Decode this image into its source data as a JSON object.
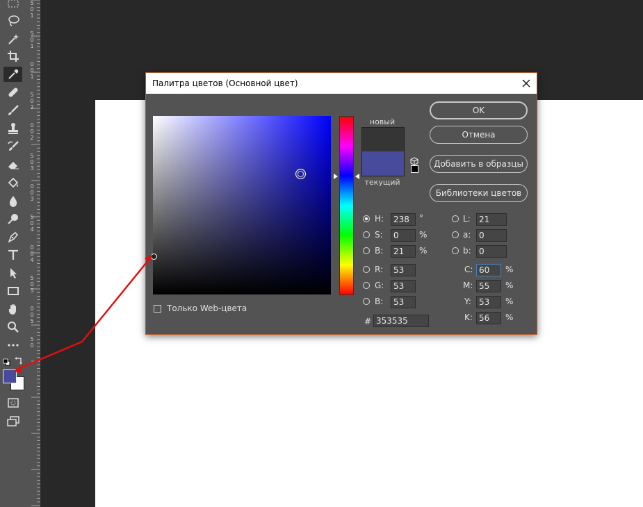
{
  "dialog": {
    "title": "Палитра цветов (Основной цвет)",
    "new_label": "новый",
    "current_label": "текущий",
    "new_color": "#353535",
    "current_color": "#484a9c",
    "buttons": {
      "ok": "OK",
      "cancel": "Отмена",
      "add_swatches": "Добавить в образцы",
      "libraries": "Библиотеки цветов"
    },
    "web_only_label": "Только Web-цвета",
    "hsb": {
      "h_label": "H:",
      "h_value": "238",
      "h_unit": "°",
      "s_label": "S:",
      "s_value": "0",
      "s_unit": "%",
      "b_label": "B:",
      "b_value": "21",
      "b_unit": "%"
    },
    "rgb": {
      "r_label": "R:",
      "r_value": "53",
      "g_label": "G:",
      "g_value": "53",
      "b_label": "B:",
      "b_value": "53"
    },
    "hex_label": "#",
    "hex_value": "353535",
    "lab": {
      "l_label": "L:",
      "l_value": "21",
      "a_label": "a:",
      "a_value": "0",
      "b_label": "b:",
      "b_value": "0"
    },
    "cmyk": {
      "c_label": "C:",
      "c_value": "60",
      "m_label": "M:",
      "m_value": "55",
      "y_label": "Y:",
      "y_value": "53",
      "k_label": "K:",
      "k_value": "56",
      "unit": "%"
    }
  },
  "toolbar": {
    "foreground_color": "#484a9c",
    "background_color": "#ffffff",
    "tools": [
      "marquee-tool",
      "lasso-tool",
      "magic-wand-tool",
      "crop-tool",
      "eyedropper-tool",
      "healing-brush-tool",
      "brush-tool",
      "clone-stamp-tool",
      "history-brush-tool",
      "eraser-tool",
      "paint-bucket-tool",
      "blur-tool",
      "dodge-tool",
      "pen-tool",
      "type-tool",
      "path-selection-tool",
      "rectangle-tool",
      "hand-tool",
      "zoom-tool",
      "more-tools",
      "quick-mask",
      "screen-mode"
    ]
  },
  "ruler": {
    "labels": [
      "5",
      "0",
      "1",
      "5",
      "0",
      "1",
      "0",
      "0",
      "1",
      "5",
      "0",
      "2",
      "0",
      "0",
      "2",
      "5",
      "0",
      "3",
      "0",
      "0",
      "3",
      "5",
      "0",
      "4",
      "0",
      "0",
      "4",
      "5",
      "0",
      "5",
      "0",
      "0",
      "5",
      "5",
      "0"
    ]
  },
  "colors": {
    "annotation_arrow": "#e01010",
    "dialog_border": "#b25a2e",
    "panel_bg": "#535353"
  }
}
